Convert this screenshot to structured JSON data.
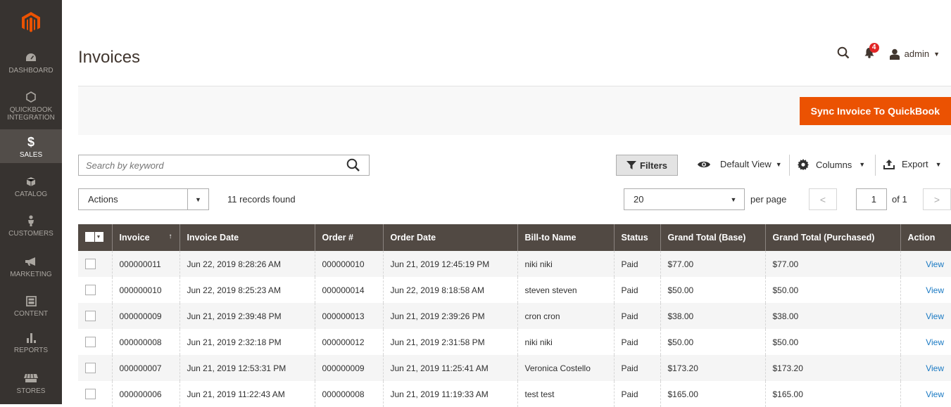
{
  "brand": {
    "accent": "#eb5202",
    "sidebar_bg": "#373330",
    "header_bg": "#514943",
    "link": "#1979c3"
  },
  "sidebar": {
    "logo_icon": "magento-logo-icon",
    "items": [
      {
        "label": "DASHBOARD",
        "icon": "speedometer-icon",
        "active": false
      },
      {
        "label": "QUICKBOOK INTEGRATION",
        "icon": "hexagon-icon",
        "active": false
      },
      {
        "label": "SALES",
        "icon": "dollar-icon",
        "active": true
      },
      {
        "label": "CATALOG",
        "icon": "box-icon",
        "active": false
      },
      {
        "label": "CUSTOMERS",
        "icon": "person-icon",
        "active": false
      },
      {
        "label": "MARKETING",
        "icon": "megaphone-icon",
        "active": false
      },
      {
        "label": "CONTENT",
        "icon": "layout-icon",
        "active": false
      },
      {
        "label": "REPORTS",
        "icon": "bar-chart-icon",
        "active": false
      },
      {
        "label": "STORES",
        "icon": "store-icon",
        "active": false
      }
    ]
  },
  "header": {
    "title": "Invoices",
    "notification_count": "4",
    "user": "admin"
  },
  "action_bar": {
    "sync_label": "Sync Invoice To QuickBook"
  },
  "toolbar": {
    "search_placeholder": "Search by keyword",
    "filters_label": "Filters",
    "view_label": "Default View",
    "columns_label": "Columns",
    "export_label": "Export",
    "actions_label": "Actions",
    "records_found": "11 records found",
    "per_page_value": "20",
    "per_page_label": "per page",
    "page_current": "1",
    "page_of": "of 1"
  },
  "table": {
    "columns": [
      "Invoice",
      "Invoice Date",
      "Order #",
      "Order Date",
      "Bill-to Name",
      "Status",
      "Grand Total (Base)",
      "Grand Total (Purchased)",
      "Action"
    ],
    "sort_indicator": "↑",
    "rows": [
      {
        "invoice": "000000011",
        "invoice_date": "Jun 22, 2019 8:28:26 AM",
        "order": "000000010",
        "order_date": "Jun 21, 2019 12:45:19 PM",
        "bill_to": "niki niki",
        "status": "Paid",
        "total_base": "$77.00",
        "total_purchased": "$77.00",
        "action": "View"
      },
      {
        "invoice": "000000010",
        "invoice_date": "Jun 22, 2019 8:25:23 AM",
        "order": "000000014",
        "order_date": "Jun 22, 2019 8:18:58 AM",
        "bill_to": "steven steven",
        "status": "Paid",
        "total_base": "$50.00",
        "total_purchased": "$50.00",
        "action": "View"
      },
      {
        "invoice": "000000009",
        "invoice_date": "Jun 21, 2019 2:39:48 PM",
        "order": "000000013",
        "order_date": "Jun 21, 2019 2:39:26 PM",
        "bill_to": "cron cron",
        "status": "Paid",
        "total_base": "$38.00",
        "total_purchased": "$38.00",
        "action": "View"
      },
      {
        "invoice": "000000008",
        "invoice_date": "Jun 21, 2019 2:32:18 PM",
        "order": "000000012",
        "order_date": "Jun 21, 2019 2:31:58 PM",
        "bill_to": "niki niki",
        "status": "Paid",
        "total_base": "$50.00",
        "total_purchased": "$50.00",
        "action": "View"
      },
      {
        "invoice": "000000007",
        "invoice_date": "Jun 21, 2019 12:53:31 PM",
        "order": "000000009",
        "order_date": "Jun 21, 2019 11:25:41 AM",
        "bill_to": "Veronica Costello",
        "status": "Paid",
        "total_base": "$173.20",
        "total_purchased": "$173.20",
        "action": "View"
      },
      {
        "invoice": "000000006",
        "invoice_date": "Jun 21, 2019 11:22:43 AM",
        "order": "000000008",
        "order_date": "Jun 21, 2019 11:19:33 AM",
        "bill_to": "test test",
        "status": "Paid",
        "total_base": "$165.00",
        "total_purchased": "$165.00",
        "action": "View"
      }
    ]
  }
}
